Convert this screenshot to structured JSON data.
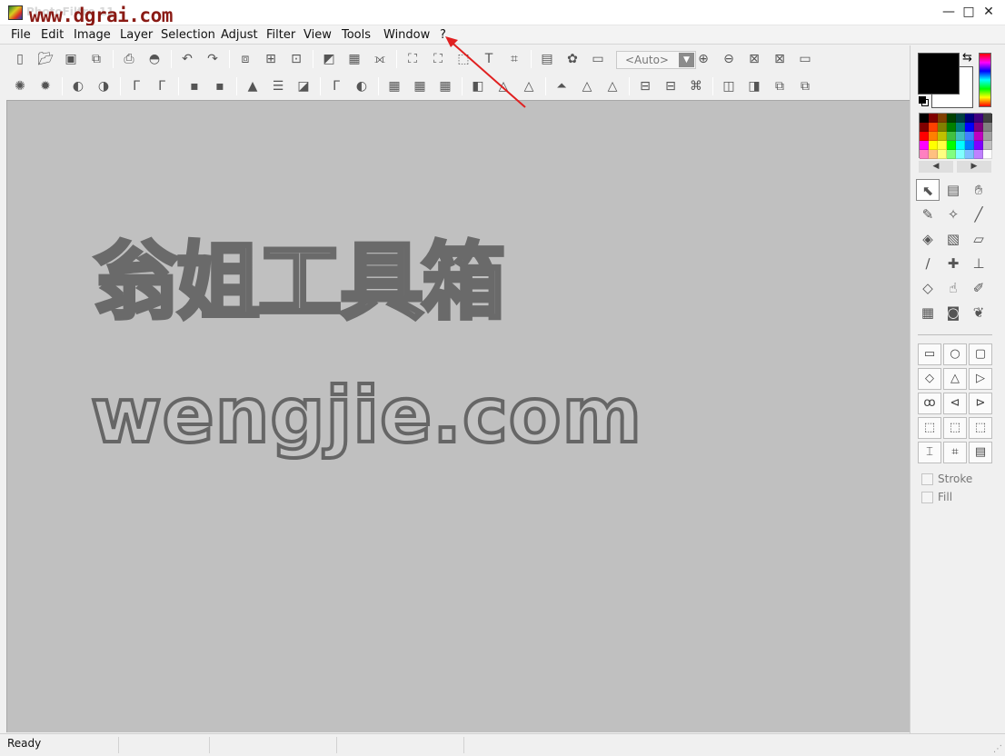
{
  "window": {
    "title": "PhotoFiltre 11",
    "watermark": "www.dgrai.com",
    "minimize_glyph": "—",
    "maximize_glyph": "□",
    "close_glyph": "✕"
  },
  "menu": [
    "File",
    "Edit",
    "Image",
    "Layer",
    "Selection",
    "Adjust",
    "Filter",
    "View",
    "Tools",
    "Window",
    "?"
  ],
  "toolbar": {
    "zoom_select_value": "<Auto>",
    "row1_icons": [
      "new-icon",
      "open-icon",
      "save-icon",
      "save-as-icon",
      "print-icon",
      "scan-icon",
      "undo-icon",
      "redo-icon",
      "copy-image-icon",
      "paste-image-icon",
      "paste-new-icon",
      "fill-icon",
      "grid-icon",
      "transform-icon",
      "image-size-icon",
      "canvas-size-icon",
      "selection-icon",
      "text-icon",
      "crop-icon",
      "explorer-icon",
      "automate-icon",
      "batch-icon",
      "zoom-in-icon",
      "zoom-out-icon",
      "fit-icon",
      "actual-size-icon",
      "slideshow-icon"
    ],
    "row2_icons": [
      "brightness-down-icon",
      "brightness-up-icon",
      "contrast-down-icon",
      "contrast-up-icon",
      "gamma-down-icon",
      "gamma-up-icon",
      "saturation-down-icon",
      "saturation-up-icon",
      "levels-icon",
      "balance-icon",
      "auto-contrast-icon",
      "auto-gamma-icon",
      "auto-levels-icon",
      "mosaic-icon",
      "blur-icon",
      "emboss-icon",
      "sharpen-icon",
      "soften-icon",
      "lighten-icon",
      "darken-icon",
      "flip-h-icon",
      "flip-v-icon",
      "rotate-icon",
      "mirror-icon",
      "effect-icon",
      "frame-icon",
      "export-icon"
    ]
  },
  "workspace": {
    "watermark_cn": "翁姐工具箱",
    "watermark_url": "wengjie.com"
  },
  "colors": {
    "foreground": "#000000",
    "background": "#ffffff",
    "palette": [
      "#000000",
      "#800000",
      "#804000",
      "#004000",
      "#004040",
      "#000080",
      "#400080",
      "#404040",
      "#800000",
      "#ff4000",
      "#808000",
      "#008000",
      "#008080",
      "#0000ff",
      "#800080",
      "#808080",
      "#ff0000",
      "#ff8000",
      "#c0c000",
      "#40c040",
      "#40c0c0",
      "#4080ff",
      "#c000c0",
      "#a0a0a0",
      "#ff00ff",
      "#ffff00",
      "#ffff40",
      "#00ff00",
      "#00ffff",
      "#0080ff",
      "#8000ff",
      "#c0c0c0",
      "#ff80c0",
      "#ffc080",
      "#ffff80",
      "#80ff80",
      "#80ffff",
      "#80c0ff",
      "#c080ff",
      "#ffffff"
    ]
  },
  "tools": [
    "pointer-tool-icon",
    "clone-tool-icon",
    "hand-tool-icon",
    "eyedropper-tool-icon",
    "magic-wand-tool-icon",
    "line-tool-icon",
    "fill-tool-icon",
    "spray-tool-icon",
    "eraser-tool-icon",
    "brush-tool-icon",
    "advanced-brush-tool-icon",
    "stamp-tool-icon",
    "drop-tool-icon",
    "finger-tool-icon",
    "retouch-tool-icon",
    "pattern-tool-icon",
    "frame-tool-icon",
    "plugin-tool-icon"
  ],
  "shapes": [
    "rectangle-shape-icon",
    "ellipse-shape-icon",
    "rounded-rect-shape-icon",
    "diamond-shape-icon",
    "triangle-shape-icon",
    "triangle-right-shape-icon",
    "lasso-shape-icon",
    "polygon-shape-icon",
    "load-shape-icon",
    "select-all-icon",
    "invert-select-icon",
    "hide-select-icon",
    "free-selection-icon",
    "move-selection-icon",
    "manage-selection-icon"
  ],
  "options": {
    "stroke_label": "Stroke",
    "fill_label": "Fill"
  },
  "status": {
    "text": "Ready"
  }
}
